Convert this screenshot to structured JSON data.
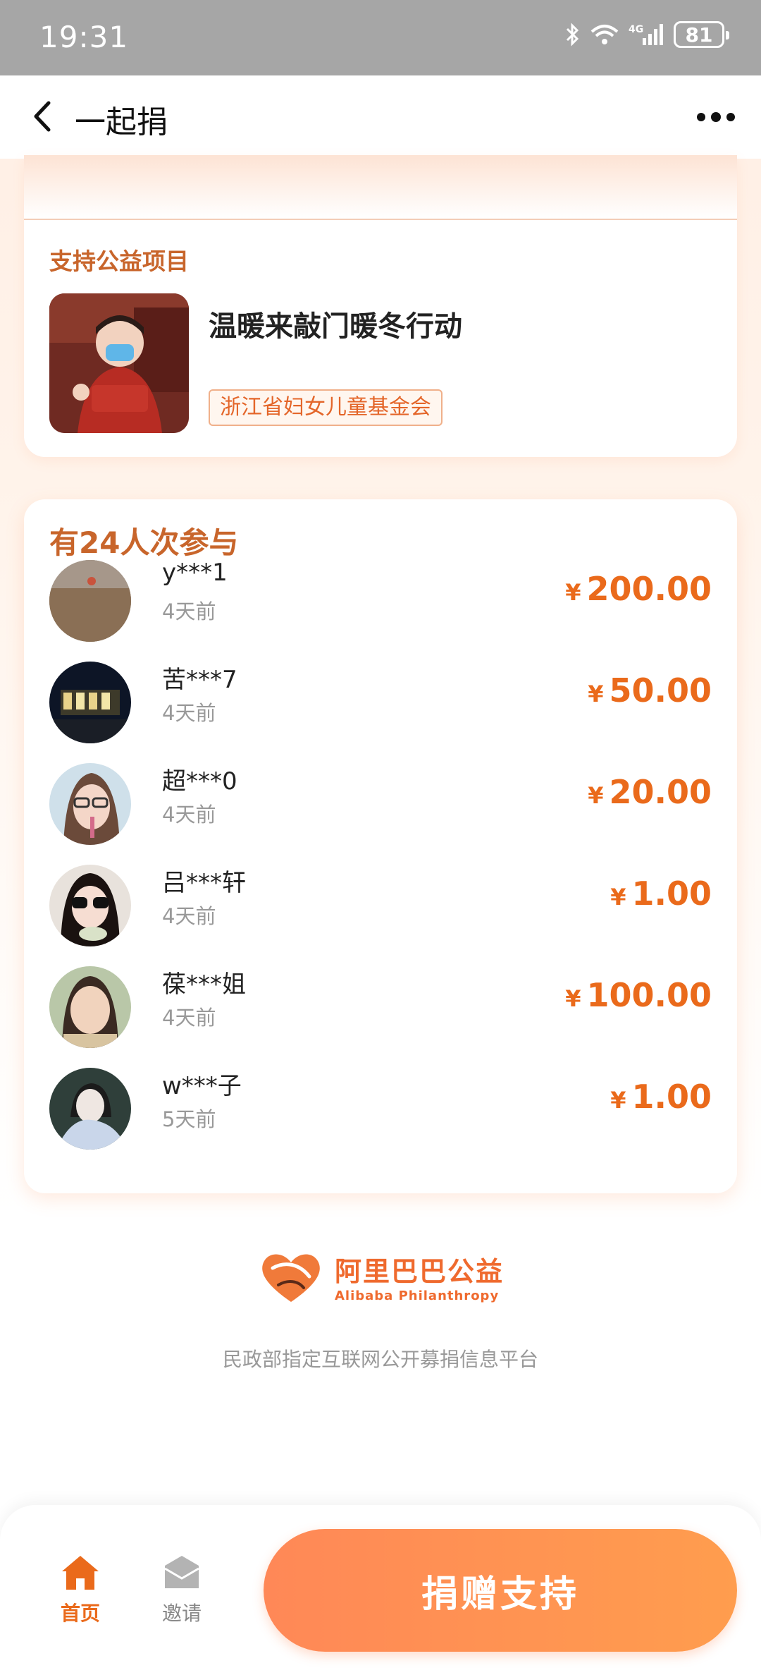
{
  "status_bar": {
    "time": "19:31",
    "battery": "81",
    "network": "4G",
    "icons": [
      "bluetooth-icon",
      "wifi-icon",
      "signal-icon",
      "battery-icon"
    ]
  },
  "nav": {
    "title": "一起捐",
    "back_icon": "chevron-left-icon",
    "more_icon": "more-dots-icon"
  },
  "project": {
    "section_title": "支持公益项目",
    "name": "温暖来敲门暖冬行动",
    "org": "浙江省妇女儿童基金会"
  },
  "participants": {
    "title": "有24人次参与",
    "currency": "¥",
    "items": [
      {
        "name": "y***1",
        "time": "4天前",
        "amount": "200.00"
      },
      {
        "name": "苦***7",
        "time": "4天前",
        "amount": "50.00"
      },
      {
        "name": "超***0",
        "time": "4天前",
        "amount": "20.00"
      },
      {
        "name": "吕***轩",
        "time": "4天前",
        "amount": "1.00"
      },
      {
        "name": "葆***姐",
        "time": "4天前",
        "amount": "100.00"
      },
      {
        "name": "w***子",
        "time": "5天前",
        "amount": "1.00"
      }
    ]
  },
  "footer": {
    "logo_cn": "阿里巴巴公益",
    "logo_en": "Alibaba Philanthropy",
    "note": "民政部指定互联网公开募捐信息平台"
  },
  "tabbar": {
    "home_label": "首页",
    "invite_label": "邀请",
    "donate_label": "捐赠支持"
  },
  "colors": {
    "accent": "#ea6a1b",
    "section_title": "#c8652b",
    "button_gradient_start": "#ff8857",
    "button_gradient_end": "#ff9d4e",
    "status_bar": "#a6a6a6"
  }
}
